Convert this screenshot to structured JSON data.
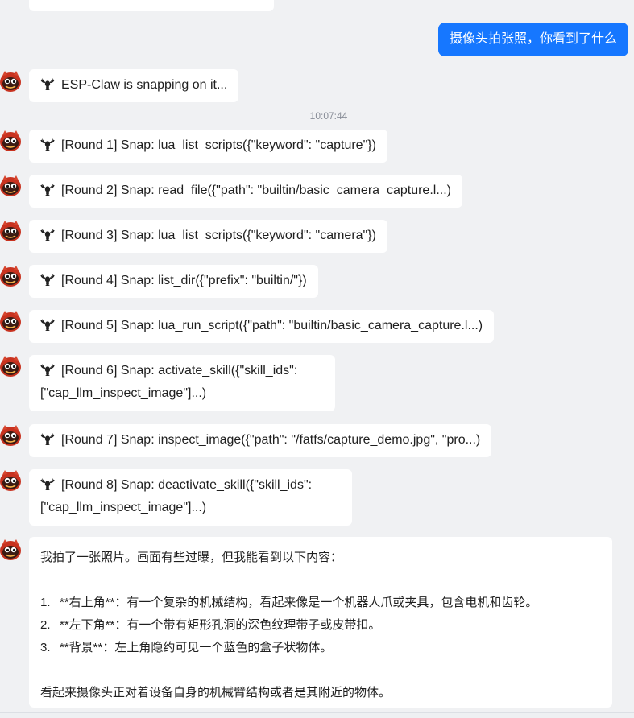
{
  "colors": {
    "background": "#f0f1f3",
    "user_bubble": "#1677ff",
    "bot_bubble": "#ffffff",
    "timestamp": "#8a8f99"
  },
  "icons": {
    "avatar": "crab-avatar-icon",
    "lobster": "lobster-icon"
  },
  "user_message": {
    "text": "摄像头拍张照，你看到了什么"
  },
  "status_message": {
    "text": "ESP-Claw is snapping on it..."
  },
  "timestamp": "10:07:44",
  "rounds": [
    {
      "text": "[Round 1] Snap: lua_list_scripts({\"keyword\": \"capture\"})"
    },
    {
      "text": "[Round 2] Snap: read_file({\"path\": \"builtin/basic_camera_capture.l...)"
    },
    {
      "text": "[Round 3] Snap: lua_list_scripts({\"keyword\": \"camera\"})"
    },
    {
      "text": "[Round 4] Snap: list_dir({\"prefix\": \"builtin/\"})"
    },
    {
      "text": "[Round 5] Snap: lua_run_script({\"path\": \"builtin/basic_camera_capture.l...)"
    },
    {
      "line1": "[Round 6] Snap: activate_skill({\"skill_ids\":",
      "line2": "[\"cap_llm_inspect_image\"]...)"
    },
    {
      "text": "[Round 7] Snap: inspect_image({\"path\": \"/fatfs/capture_demo.jpg\", \"pro...)"
    },
    {
      "line1": "[Round 8] Snap: deactivate_skill({\"skill_ids\":",
      "line2": "[\"cap_llm_inspect_image\"]...)"
    }
  ],
  "final_answer": {
    "intro": "我拍了一张照片。画面有些过曝，但我能看到以下内容：",
    "items": [
      {
        "num": "1.",
        "text": "**右上角**：有一个复杂的机械结构，看起来像是一个机器人爪或夹具，包含电机和齿轮。"
      },
      {
        "num": "2.",
        "text": "**左下角**：有一个带有矩形孔洞的深色纹理带子或皮带扣。"
      },
      {
        "num": "3.",
        "text": "**背景**：左上角隐约可见一个蓝色的盒子状物体。"
      }
    ],
    "conclusion": "看起来摄像头正对着设备自身的机械臂结构或者是其附近的物体。"
  }
}
